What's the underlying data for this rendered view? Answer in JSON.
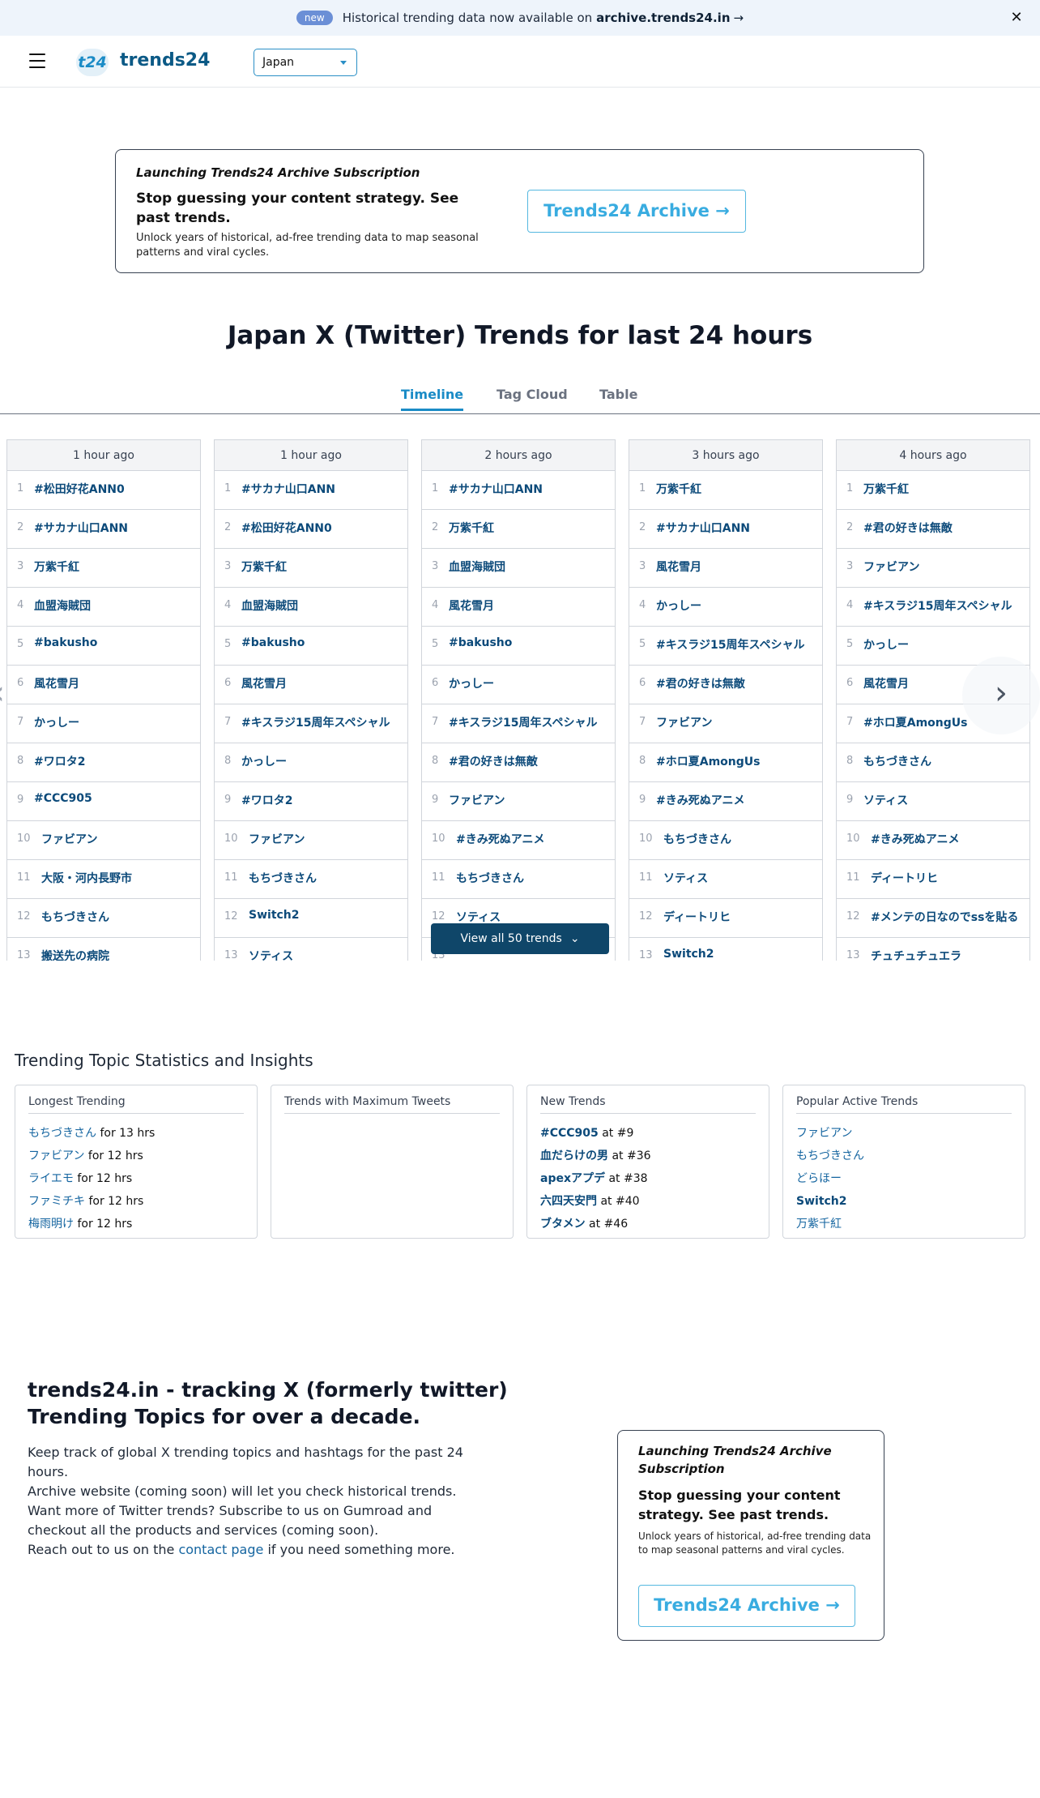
{
  "announcement": {
    "badge": "new",
    "text": "Historical trending data now available on",
    "site": "archive.trends24.in",
    "arrow": "→",
    "close": "✕"
  },
  "header": {
    "logo_mark": "t24",
    "logo_text": "trends24",
    "country": "Japan"
  },
  "promo": {
    "kicker": "Launching Trends24 Archive Subscription",
    "headline": "Stop guessing your content strategy. See past trends.",
    "sub": "Unlock years of historical, ad-free trending data to map seasonal patterns and viral cycles.",
    "cta": "Trends24 Archive →"
  },
  "page_title": "Japan X (Twitter) Trends for last 24 hours",
  "tabs": [
    "Timeline",
    "Tag Cloud",
    "Table"
  ],
  "timeline": {
    "columns": [
      {
        "time": "1 hour ago",
        "trends": [
          "#松田好花ANN0",
          "#サカナ山口ANN",
          "万紫千紅",
          "血盟海賊団",
          "#bakusho",
          "風花雪月",
          "かっしー",
          "#ワロタ2",
          "#CCC905",
          "ファビアン",
          "大阪・河内長野市",
          "もちづきさん",
          "搬送先の病院"
        ]
      },
      {
        "time": "1 hour ago",
        "trends": [
          "#サカナ山口ANN",
          "#松田好花ANN0",
          "万紫千紅",
          "血盟海賊団",
          "#bakusho",
          "風花雪月",
          "#キスラジ15周年スペシャル",
          "かっしー",
          "#ワロタ2",
          "ファビアン",
          "もちづきさん",
          "Switch2",
          "ソティス"
        ]
      },
      {
        "time": "2 hours ago",
        "trends": [
          "#サカナ山口ANN",
          "万紫千紅",
          "血盟海賊団",
          "風花雪月",
          "#bakusho",
          "かっしー",
          "#キスラジ15周年スペシャル",
          "#君の好きは無敵",
          "ファビアン",
          "#きみ死ぬアニメ",
          "もちづきさん",
          "ソティス",
          ""
        ]
      },
      {
        "time": "3 hours ago",
        "trends": [
          "万紫千紅",
          "#サカナ山口ANN",
          "風花雪月",
          "かっしー",
          "#キスラジ15周年スペシャル",
          "#君の好きは無敵",
          "ファビアン",
          "#ホロ夏AmongUs",
          "#きみ死ぬアニメ",
          "もちづきさん",
          "ソティス",
          "ディートリヒ",
          "Switch2"
        ]
      },
      {
        "time": "4 hours ago",
        "trends": [
          "万紫千紅",
          "#君の好きは無敵",
          "ファビアン",
          "#キスラジ15周年スペシャル",
          "かっしー",
          "風花雪月",
          "#ホロ夏AmongUs",
          "もちづきさん",
          "ソティス",
          "#きみ死ぬアニメ",
          "ディートリヒ",
          "#メンテの日なのでssを貼る",
          "チュチュチュエラ"
        ]
      }
    ],
    "view_all": "View all 50 trends",
    "prev": "‹",
    "next": "›"
  },
  "insights": {
    "title": "Trending Topic Statistics and Insights",
    "longest": {
      "title": "Longest Trending",
      "items": [
        {
          "name": "もちづきさん",
          "suffix": " for 13 hrs"
        },
        {
          "name": "ファビアン",
          "suffix": " for 12 hrs"
        },
        {
          "name": "ライエモ",
          "suffix": " for 12 hrs"
        },
        {
          "name": "ファミチキ",
          "suffix": " for 12 hrs"
        },
        {
          "name": "梅雨明け",
          "suffix": " for 12 hrs"
        }
      ]
    },
    "max_tweets": {
      "title": "Trends with Maximum Tweets"
    },
    "new_trends": {
      "title": "New Trends",
      "items": [
        {
          "name": "#CCC905",
          "suffix": " at #9"
        },
        {
          "name": "血だらけの男",
          "suffix": " at #36"
        },
        {
          "name": "apexアプデ",
          "suffix": " at #38"
        },
        {
          "name": "六四天安門",
          "suffix": " at #40"
        },
        {
          "name": "ブタメン",
          "suffix": " at #46"
        }
      ]
    },
    "popular": {
      "title": "Popular Active Trends",
      "items": [
        "ファビアン",
        "もちづきさん",
        "どらほー",
        "Switch2",
        "万紫千紅"
      ]
    }
  },
  "about": {
    "title": "trends24.in - tracking X (formerly twitter) Trending Topics for over a decade.",
    "line1": "Keep track of global X trending topics and hashtags for the past 24 hours.",
    "line2": "Archive website (coming soon) will let you check historical trends.",
    "line3": "Want more of Twitter trends? Subscribe to us on Gumroad and checkout all the products and services (coming soon).",
    "line4_pre": "Reach out to us on the",
    "line4_link": "contact page",
    "line4_post": "if you need something more."
  },
  "promo2": {
    "kicker": "Launching Trends24 Archive Subscription",
    "headline": "Stop guessing your content strategy. See past trends.",
    "sub": "Unlock years of historical, ad-free trending data to map seasonal patterns and viral cycles.",
    "cta": "Trends24 Archive →"
  }
}
